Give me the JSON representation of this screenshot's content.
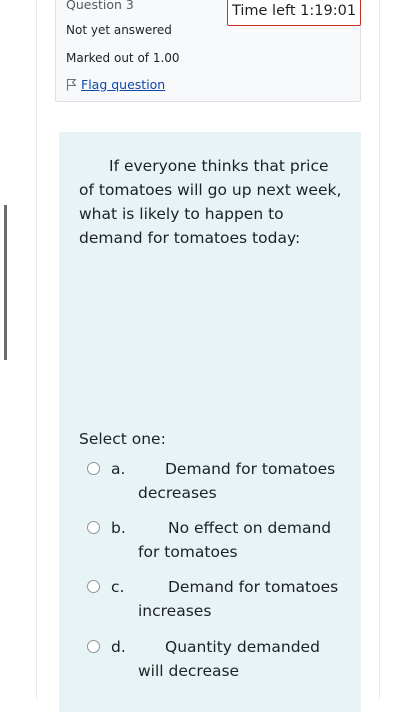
{
  "question": {
    "title": "Question 3",
    "state": "Not yet answered",
    "grade": "Marked out of 1.00",
    "flag_label": "Flag question",
    "text": "If everyone thinks that price of tomatoes will go up next week, what is likely to happen to demand for tomatoes today:",
    "prompt": "Select one:",
    "options": [
      {
        "letter": "a.",
        "text": "Demand for tomatoes decreases"
      },
      {
        "letter": "b.",
        "text": "No effect on demand for tomatoes"
      },
      {
        "letter": "c.",
        "text": "Demand for tomatoes increases"
      },
      {
        "letter": "d.",
        "text": "Quantity demanded will decrease"
      }
    ]
  },
  "timer": {
    "label": "Time left 1:19:01"
  },
  "colors": {
    "formulation_bg": "#e7f3f5",
    "info_bg": "#f8f9fa",
    "timer_border": "#ca3120",
    "link": "#0f47ad"
  },
  "icons": {
    "flag": "flag-icon"
  }
}
